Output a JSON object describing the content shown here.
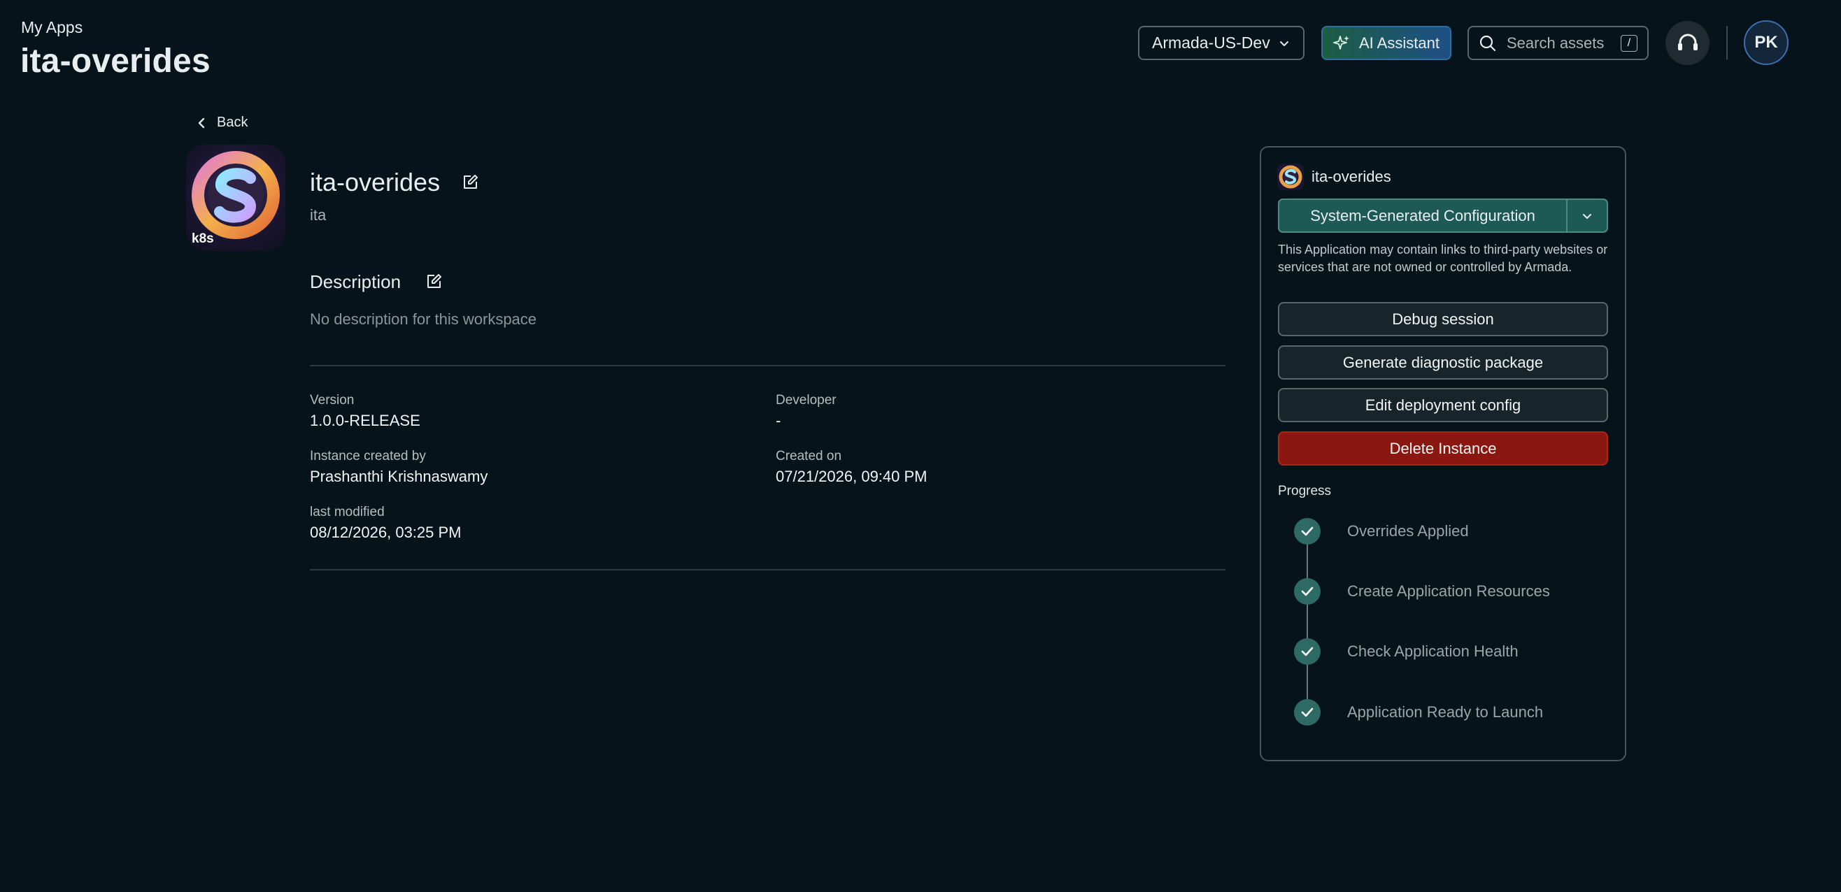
{
  "header": {
    "breadcrumb": "My Apps",
    "title": "ita-overides",
    "region": "Armada-US-Dev",
    "ai_assistant": "AI Assistant",
    "search_placeholder": "Search assets",
    "search_shortcut": "/",
    "avatar_initials": "PK"
  },
  "back_label": "Back",
  "app": {
    "name": "ita-overides",
    "subtitle": "ita",
    "icon_badge": "k8s",
    "description_heading": "Description",
    "description_text": "No description for this workspace",
    "fields": {
      "version_label": "Version",
      "version_value": "1.0.0-RELEASE",
      "developer_label": "Developer",
      "developer_value": "-",
      "created_by_label": "Instance created by",
      "created_by_value": "Prashanthi Krishnaswamy",
      "created_on_label": "Created on",
      "created_on_value": "07/21/2026, 09:40 PM",
      "modified_label": "last modified",
      "modified_value": "08/12/2026, 03:25 PM"
    }
  },
  "panel": {
    "name": "ita-overides",
    "config_label": "System-Generated Configuration",
    "note": "This Application may contain links to third-party websites or services that are not owned or controlled by Armada.",
    "actions": {
      "debug": "Debug session",
      "diagnostic": "Generate diagnostic package",
      "edit_config": "Edit deployment config",
      "delete": "Delete Instance"
    },
    "progress_heading": "Progress",
    "steps": [
      "Overrides Applied",
      "Create Application Resources",
      "Check Application Health",
      "Application Ready to Launch"
    ]
  },
  "colors": {
    "background": "#06131a",
    "accent_teal": "#1e5a55",
    "danger": "#8a1810",
    "step_complete": "#2e6a64"
  }
}
